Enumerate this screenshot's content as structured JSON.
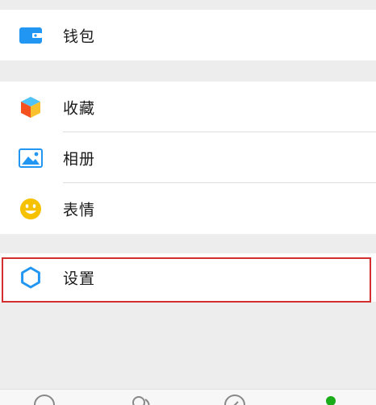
{
  "menu": {
    "wallet": {
      "label": "钱包",
      "icon": "wallet-icon"
    },
    "favorites": {
      "label": "收藏",
      "icon": "cube-icon"
    },
    "album": {
      "label": "相册",
      "icon": "picture-icon"
    },
    "stickers": {
      "label": "表情",
      "icon": "smiley-icon"
    },
    "settings": {
      "label": "设置",
      "icon": "gear-icon"
    }
  },
  "colors": {
    "highlight": "#d32f2f",
    "accent_blue": "#2196f3",
    "accent_yellow": "#f6c100",
    "tab_active": "#1aad19"
  },
  "tabbar": {
    "tabs": [
      {
        "icon": "chat-icon"
      },
      {
        "icon": "contacts-icon"
      },
      {
        "icon": "discover-icon"
      },
      {
        "icon": "me-icon"
      }
    ]
  }
}
